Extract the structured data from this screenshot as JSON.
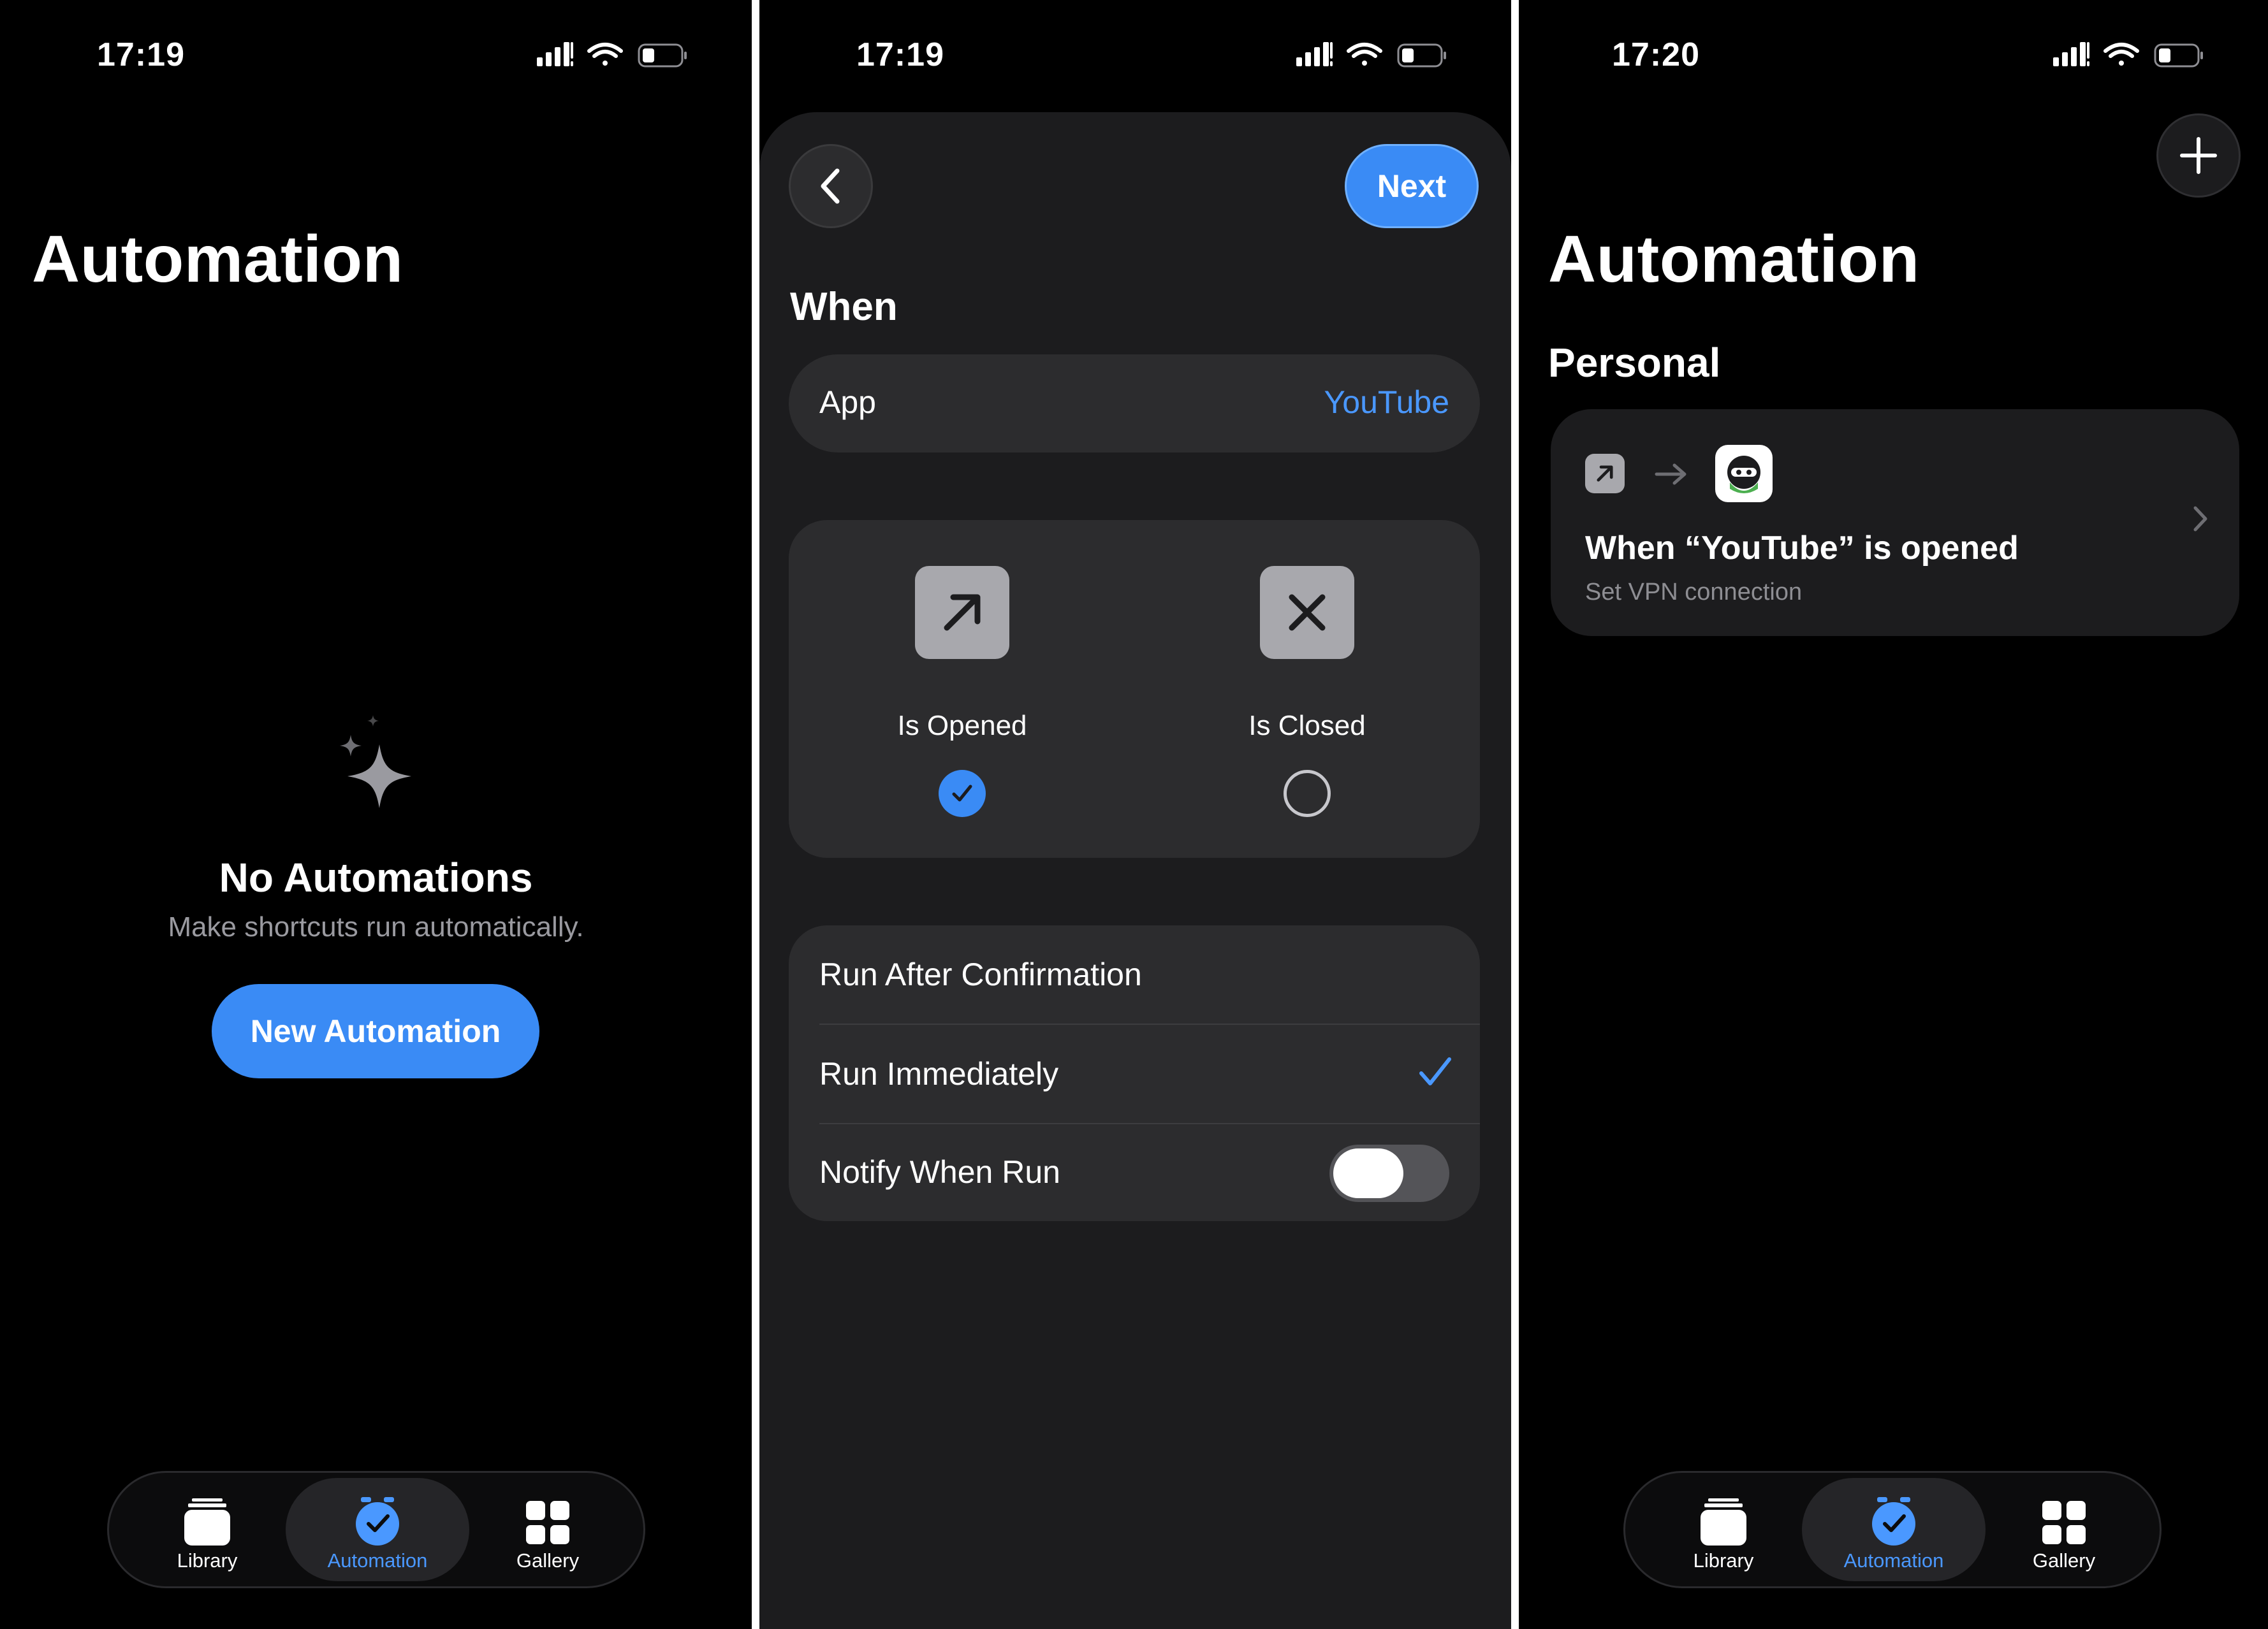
{
  "screen1": {
    "status": {
      "time": "17:19"
    },
    "title": "Automation",
    "empty_state": {
      "icon": "sparkles-icon",
      "title": "No Automations",
      "subtitle": "Make shortcuts run automatically."
    },
    "new_automation_label": "New Automation",
    "tabs": [
      {
        "label": "Library",
        "icon": "library-icon",
        "active": false
      },
      {
        "label": "Automation",
        "icon": "automation-clock-icon",
        "active": true
      },
      {
        "label": "Gallery",
        "icon": "gallery-grid-icon",
        "active": false
      }
    ]
  },
  "screen2": {
    "status": {
      "time": "17:19"
    },
    "next_label": "Next",
    "section_title": "When",
    "app_row": {
      "label": "App",
      "value": "YouTube"
    },
    "options": [
      {
        "label": "Is Opened",
        "icon": "arrow-up-right-icon",
        "selected": true
      },
      {
        "label": "Is Closed",
        "icon": "x-mark-icon",
        "selected": false
      }
    ],
    "run_rows": [
      {
        "label": "Run After Confirmation",
        "checked": false
      },
      {
        "label": "Run Immediately",
        "checked": true
      },
      {
        "label": "Notify When Run",
        "toggle": false
      }
    ]
  },
  "screen3": {
    "status": {
      "time": "17:20"
    },
    "title": "Automation",
    "section": "Personal",
    "automation": {
      "title": "When “YouTube” is opened",
      "subtitle": "Set VPN connection",
      "trigger_icon": "arrow-up-right-icon",
      "app_icon": "vpn-ninja-app-icon"
    },
    "tabs": [
      {
        "label": "Library",
        "icon": "library-icon",
        "active": false
      },
      {
        "label": "Automation",
        "icon": "automation-clock-icon",
        "active": true
      },
      {
        "label": "Gallery",
        "icon": "gallery-grid-icon",
        "active": false
      }
    ]
  },
  "colors": {
    "accent": "#3a8bf5",
    "link": "#4a98ff",
    "background": "#000000",
    "card": "#2c2c2e",
    "secondary_text": "#9a9aa0"
  }
}
